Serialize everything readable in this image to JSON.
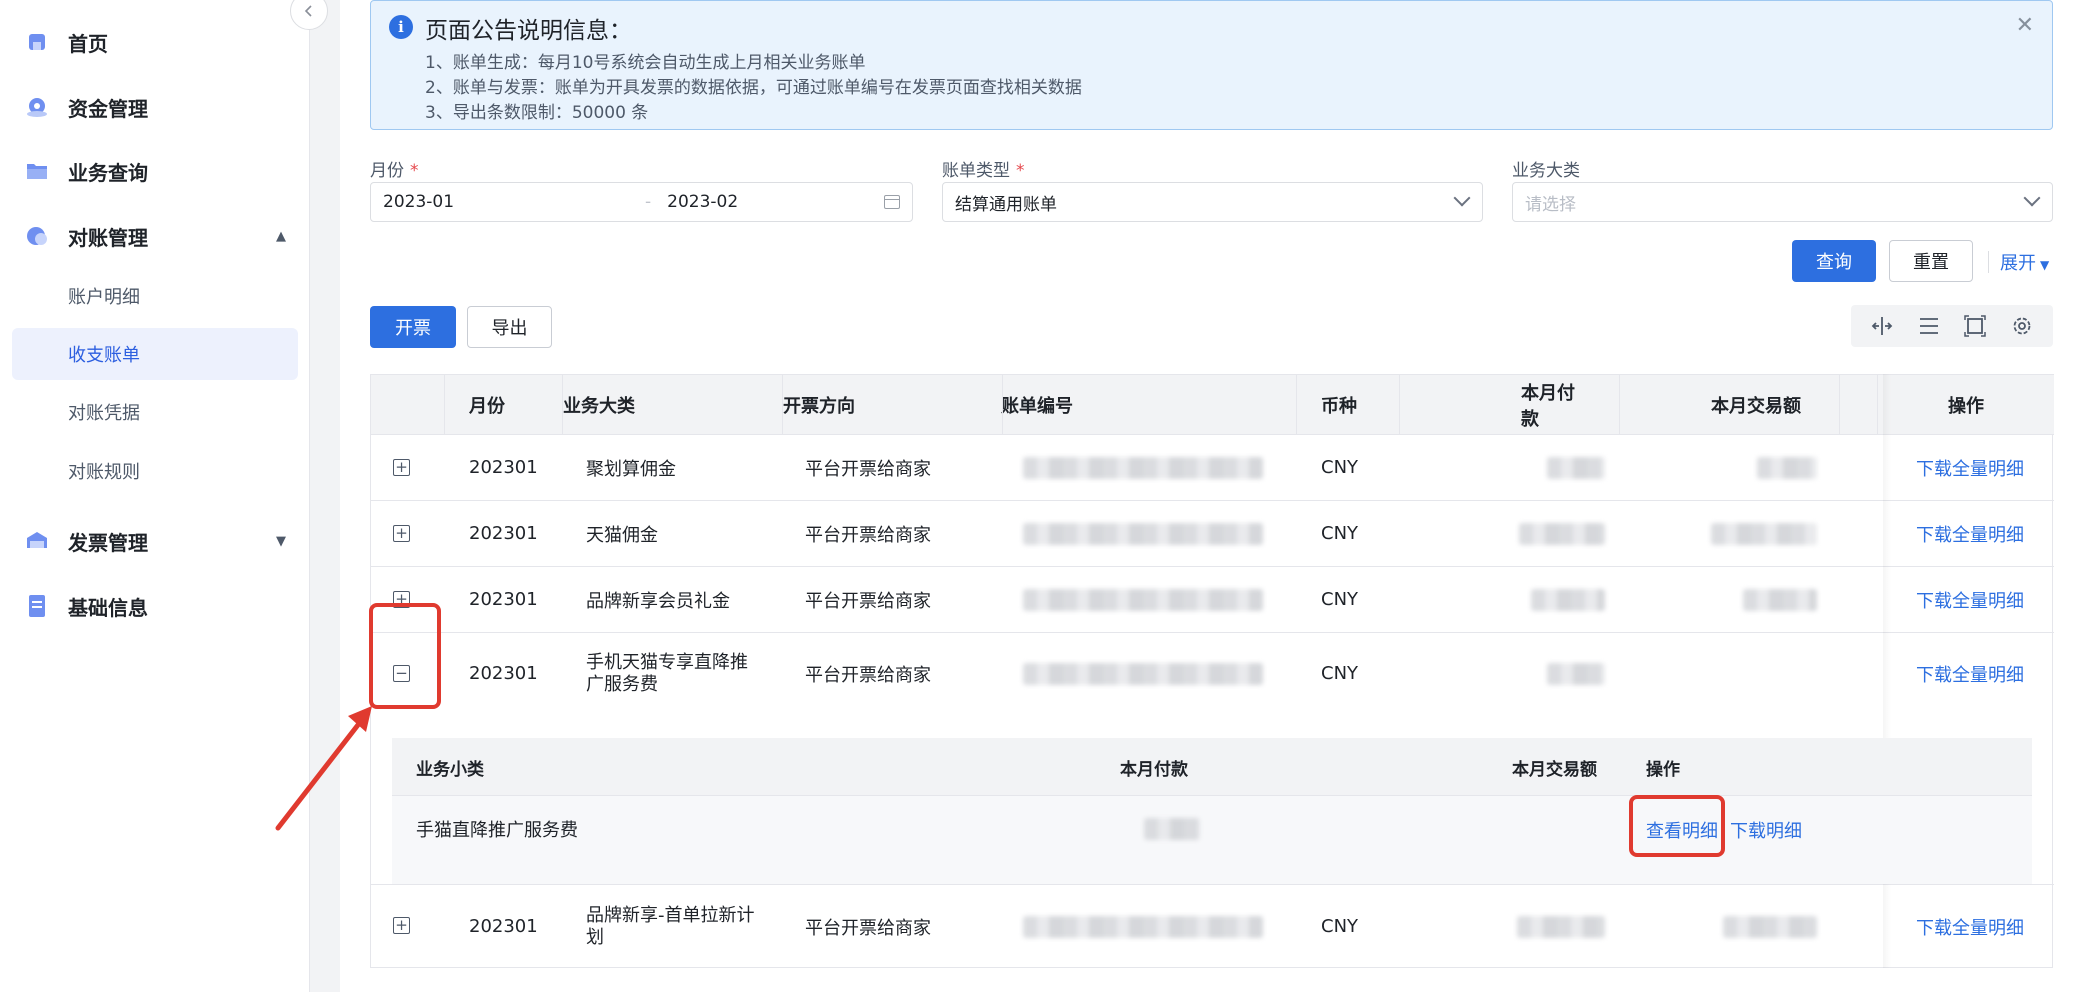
{
  "sidebar": {
    "items": [
      {
        "label": "首页",
        "icon": "home-icon"
      },
      {
        "label": "资金管理",
        "icon": "fund-icon"
      },
      {
        "label": "业务查询",
        "icon": "folder-icon"
      },
      {
        "label": "对账管理",
        "icon": "reconcile-icon",
        "expanded": true
      },
      {
        "label": "发票管理",
        "icon": "invoice-icon",
        "expanded": false
      },
      {
        "label": "基础信息",
        "icon": "info-doc-icon"
      }
    ],
    "sub_items": [
      {
        "label": "账户明细"
      },
      {
        "label": "收支账单",
        "active": true
      },
      {
        "label": "对账凭据"
      },
      {
        "label": "对账规则"
      }
    ],
    "collapse_icon": "chevron-left-icon"
  },
  "notice": {
    "title": "页面公告说明信息：",
    "lines": [
      "1、账单生成：每月10号系统会自动生成上月相关业务账单",
      "2、账单与发票：账单为开具发票的数据依据，可通过账单编号在发票页面查找相关数据",
      "3、导出条数限制：50000 条"
    ],
    "close_icon": "close-icon"
  },
  "filters": {
    "month": {
      "label": "月份",
      "required": "*",
      "start": "2023-01",
      "separator": "-",
      "end": "2023-02"
    },
    "bill_type": {
      "label": "账单类型",
      "required": "*",
      "value": "结算通用账单"
    },
    "category": {
      "label": "业务大类",
      "placeholder": "请选择"
    }
  },
  "actions": {
    "query": "查询",
    "reset": "重置",
    "expand": "展开",
    "invoice": "开票",
    "export": "导出"
  },
  "table": {
    "columns": [
      "月份",
      "业务大类",
      "开票方向",
      "账单编号",
      "币种",
      "本月付款",
      "本月交易额",
      "操作"
    ],
    "rows": [
      {
        "month": "202301",
        "category": "聚划算佣金",
        "direction": "平台开票给商家",
        "currency": "CNY",
        "op": "下载全量明细",
        "expander": "+"
      },
      {
        "month": "202301",
        "category": "天猫佣金",
        "direction": "平台开票给商家",
        "currency": "CNY",
        "op": "下载全量明细",
        "expander": "+"
      },
      {
        "month": "202301",
        "category": "品牌新享会员礼金",
        "direction": "平台开票给商家",
        "currency": "CNY",
        "op": "下载全量明细",
        "expander": "+"
      },
      {
        "month": "202301",
        "category": "手机天猫专享直降推广服务费",
        "direction": "平台开票给商家",
        "currency": "CNY",
        "op": "下载全量明细",
        "expander": "−"
      },
      {
        "month": "202301",
        "category": "品牌新享-首单拉新计划",
        "direction": "平台开票给商家",
        "currency": "CNY",
        "op": "下载全量明细",
        "expander": "+"
      }
    ],
    "subtable": {
      "columns": [
        "业务小类",
        "本月付款",
        "本月交易额",
        "操作"
      ],
      "row": {
        "subcategory": "手猫直降推广服务费",
        "view": "查看明细",
        "download": "下载明细"
      }
    }
  },
  "colors": {
    "primary": "#2d6fe0",
    "annotation": "#e03a2f"
  }
}
